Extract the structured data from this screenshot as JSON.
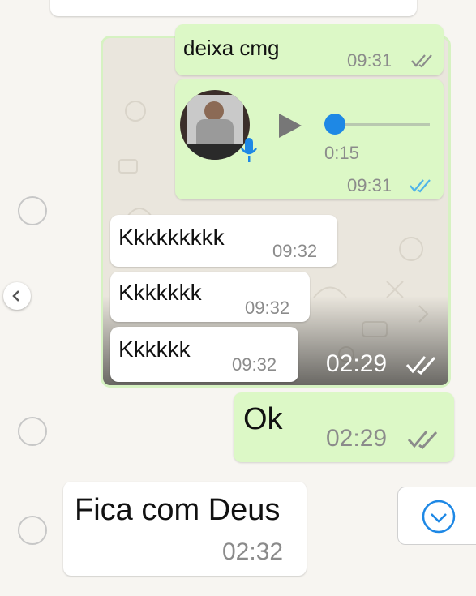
{
  "forwarded_block": {
    "partial_text": "deixa cmg",
    "partial_time": "09:31",
    "audio": {
      "duration": "0:15",
      "time": "09:31",
      "progress": 0.0
    },
    "messages": [
      {
        "text": "Kkkkkkkkk",
        "time": "09:32"
      },
      {
        "text": "Kkkkkkk",
        "time": "09:32"
      },
      {
        "text": "Kkkkkk",
        "time": "09:32"
      }
    ],
    "overlay_time": "02:29"
  },
  "ok_message": {
    "text": "Ok",
    "time": "02:29"
  },
  "incoming_message": {
    "text": "Fica com Deus",
    "time": "02:32"
  },
  "colors": {
    "outgoing_bubble": "#dcf8c6",
    "incoming_bubble": "#ffffff",
    "read_tick": "#4fb4e8",
    "accent": "#1e88e5"
  }
}
